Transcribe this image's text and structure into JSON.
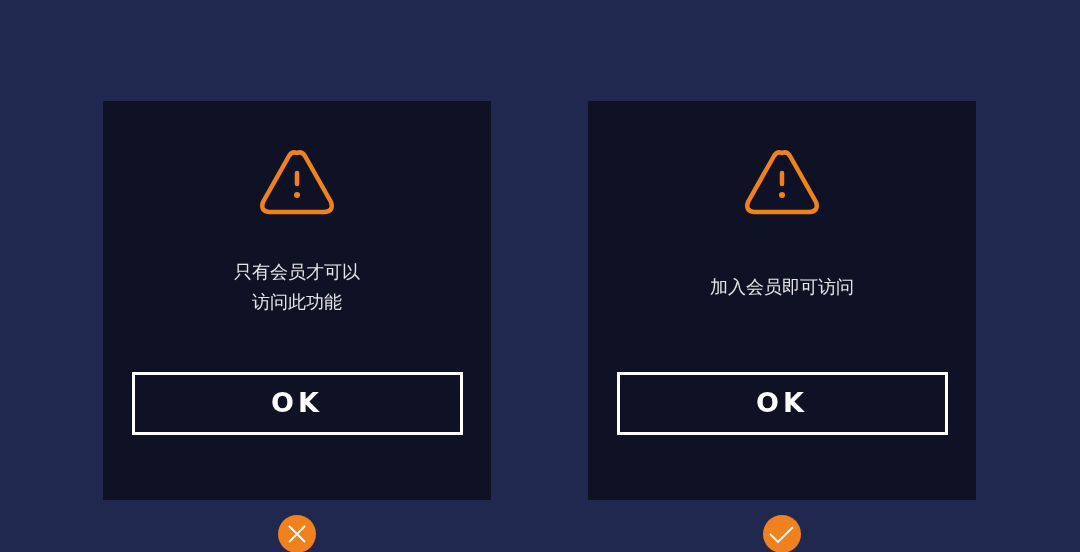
{
  "dialogs": [
    {
      "message_lines": [
        "只有会员才可以",
        "访问此功能"
      ],
      "button": "OK",
      "verdict": {
        "kind": "wrong"
      }
    },
    {
      "message_lines": [
        "加入会员即可访问"
      ],
      "button": "OK",
      "verdict": {
        "kind": "right"
      }
    }
  ]
}
